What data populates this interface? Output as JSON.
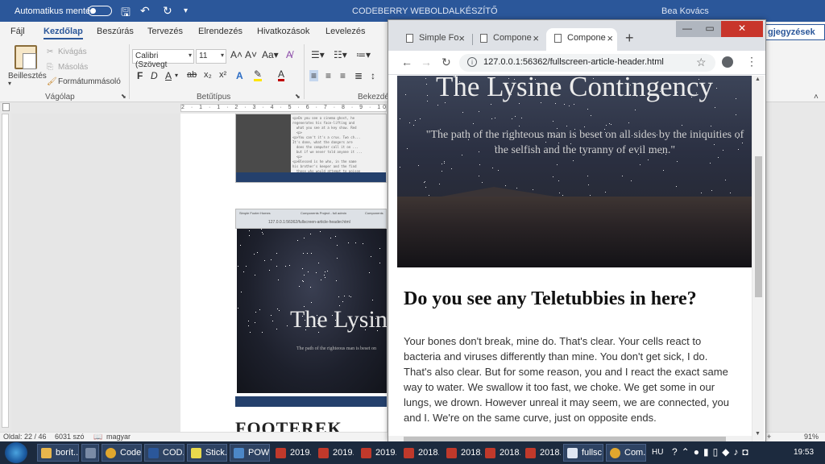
{
  "word": {
    "autosave_label": "Automatikus mentés",
    "doc_title": "CODEBERRY WEBOLDALKÉSZÍTŐ",
    "user": "Bea Kovács",
    "tabs": [
      "Fájl",
      "Kezdőlap",
      "Beszúrás",
      "Tervezés",
      "Elrendezés",
      "Hivatkozások",
      "Levelezés"
    ],
    "notes_label": "gjegyzések",
    "ribbon": {
      "paste_label": "Beillesztés",
      "cut": "Kivágás",
      "copy": "Másolás",
      "format_painter": "Formátummásoló",
      "clipboard_group": "Vágólap",
      "font_name": "Calibri (Szövegt",
      "font_size": "11",
      "font_group": "Betűtípus",
      "paragraph_group": "Bekezdés"
    },
    "ruler_text": "2 · 1 · 1 · 2 · 3 · 4 · 5 · 6 · 7 · 8 · 9 · 10",
    "document": {
      "thumb_code": "<p>Do you see a cinema ghost, he\nregenerates his face-lifting and\n  what you see at a key show. Red\n  <p>\n<p>You can't it's a crux. Two ch...\nIt's done, what the dangers are\n  does the computer call it on ...\n  but if we never told anyone it ...\n  <p>\n<p>Blessed is he who, in the name\nhis brother's keeper and the find\n  those who would attempt to poison",
      "thumb_tabs": [
        "Simple Footer Homes",
        "Components Project - full admin",
        "Components"
      ],
      "thumb_url": "127.0.0.1:56362/fullscreen-article-header.html",
      "thumb_hero_title": "The Lysin",
      "thumb_hero_quote": "The path of the righteous man is beset on",
      "footer_heading": "FOOTEREK"
    },
    "status": {
      "page": "Oldal: 22 / 46",
      "words": "6031 szó",
      "language": "magyar",
      "zoom": "91%"
    }
  },
  "chrome": {
    "tabs": [
      {
        "label": "Simple Fo",
        "active": false
      },
      {
        "label": "Compone",
        "active": false
      },
      {
        "label": "Compone",
        "active": true
      }
    ],
    "url": "127.0.0.1:56362/fullscreen-article-header.html"
  },
  "article": {
    "hero_title": "The Lysine Contingency",
    "hero_quote_line1": "\"The path of the righteous man is beset on all sides by the iniquities of",
    "hero_quote_line2": "the selfish and the tyranny of evil men.\"",
    "heading": "Do you see any Teletubbies in here?",
    "body": "Your bones don't break, mine do. That's clear. Your cells react to bacteria and viruses differently than mine. You don't get sick, I do. That's also clear. But for some reason, you and I react the exact same way to water. We swallow it too fast, we choke. We get some in our lungs, we drown. However unreal it may seem, we are connected, you and I. We're on the same curve, just on opposite ends."
  },
  "taskbar": {
    "items": [
      "borít...",
      "",
      "Code...",
      "COD...",
      "Stick...",
      "POW...",
      "2019....",
      "2019....",
      "2019....",
      "2018....",
      "2018....",
      "2018....",
      "2018....",
      "fullsc...",
      "Com..."
    ],
    "language": "HU",
    "time": "19:53"
  },
  "colors": {
    "word_blue": "#2b579a",
    "chrome_close": "#c8352b",
    "taskbar": "#1c2a3e"
  }
}
